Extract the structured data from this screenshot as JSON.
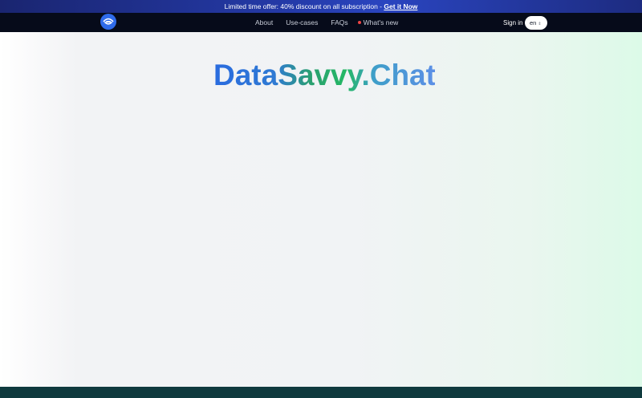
{
  "promo": {
    "text": "Limited time offer: 40% discount on all subscription - ",
    "cta": "Get it Now"
  },
  "nav": {
    "logo_icon": "datasavvy-logo-icon",
    "links": {
      "about": "About",
      "use_cases": "Use-cases",
      "faqs": "FAQs",
      "whats_new": "What's new"
    },
    "sign_in": "Sign in",
    "language": "en"
  },
  "hero": {
    "brand": "DataSavvy.Chat"
  },
  "colors": {
    "promo_bg": "#243aa8",
    "nav_bg": "#060b1a",
    "brand_blue": "#2a6bdf",
    "brand_green": "#24b864",
    "news_dot": "#ef4444",
    "footer_bg": "#0f3a3e"
  }
}
